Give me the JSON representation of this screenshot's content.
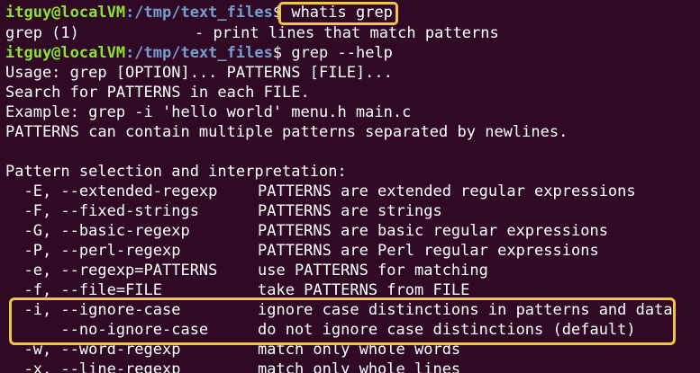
{
  "prompt": {
    "user": "itguy@localVM",
    "path": ":/tmp/text_files",
    "symbol": "$"
  },
  "commands": {
    "first": "whatis grep",
    "second": "grep --help"
  },
  "whatis_output": {
    "name": "grep (1)",
    "desc": "- print lines that match patterns"
  },
  "help": {
    "usage": "Usage: grep [OPTION]... PATTERNS [FILE]...",
    "search": "Search for PATTERNS in each FILE.",
    "example": "Example: grep -i 'hello world' menu.h main.c",
    "patterns_note": "PATTERNS can contain multiple patterns separated by newlines.",
    "section_title": "Pattern selection and interpretation:",
    "options": [
      {
        "flag": "  -E, --extended-regexp",
        "desc": "PATTERNS are extended regular expressions"
      },
      {
        "flag": "  -F, --fixed-strings",
        "desc": "PATTERNS are strings"
      },
      {
        "flag": "  -G, --basic-regexp",
        "desc": "PATTERNS are basic regular expressions"
      },
      {
        "flag": "  -P, --perl-regexp",
        "desc": "PATTERNS are Perl regular expressions"
      },
      {
        "flag": "  -e, --regexp=PATTERNS",
        "desc": "use PATTERNS for matching"
      },
      {
        "flag": "  -f, --file=FILE",
        "desc": "take PATTERNS from FILE"
      },
      {
        "flag": "  -i, --ignore-case",
        "desc": "ignore case distinctions in patterns and data"
      },
      {
        "flag": "      --no-ignore-case",
        "desc": "do not ignore case distinctions (default)"
      },
      {
        "flag": "  -w, --word-regexp",
        "desc": "match only whole words"
      },
      {
        "flag": "  -x, --line-regexp",
        "desc": "match only whole lines"
      }
    ]
  },
  "highlight_color": "#f4c542"
}
